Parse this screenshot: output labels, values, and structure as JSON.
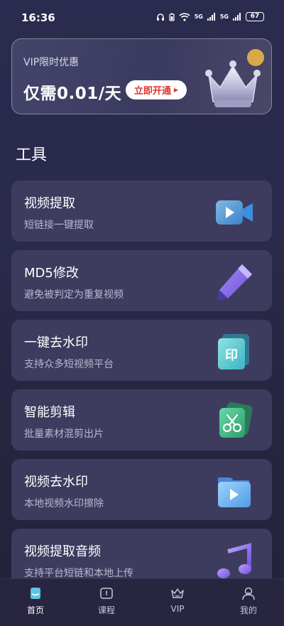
{
  "status": {
    "time": "16:36",
    "net1": "5G",
    "net2": "5G",
    "battery": "67"
  },
  "vip_banner": {
    "subtitle": "VIP限时优惠",
    "price": "仅需0.01/天",
    "button": "立即开通"
  },
  "tools": {
    "title": "工具",
    "items": [
      {
        "name": "视频提取",
        "desc": "短链接一键提取",
        "icon": "video-camera-icon"
      },
      {
        "name": "MD5修改",
        "desc": "避免被判定为重复视频",
        "icon": "pen-icon"
      },
      {
        "name": "一键去水印",
        "desc": "支持众多短视频平台",
        "icon": "stamp-icon"
      },
      {
        "name": "智能剪辑",
        "desc": "批量素材混剪出片",
        "icon": "scissors-icon"
      },
      {
        "name": "视频去水印",
        "desc": "本地视频水印擦除",
        "icon": "video-file-icon"
      },
      {
        "name": "视频提取音频",
        "desc": "支持平台短链和本地上传",
        "icon": "music-note-icon"
      }
    ]
  },
  "nav": {
    "home": "首页",
    "course": "课程",
    "vip": "VIP",
    "mine": "我的"
  },
  "colors": {
    "accent_red": "#e0352b",
    "card_bg": "#3d3c5f",
    "active_nav": "#5fc2e6"
  }
}
